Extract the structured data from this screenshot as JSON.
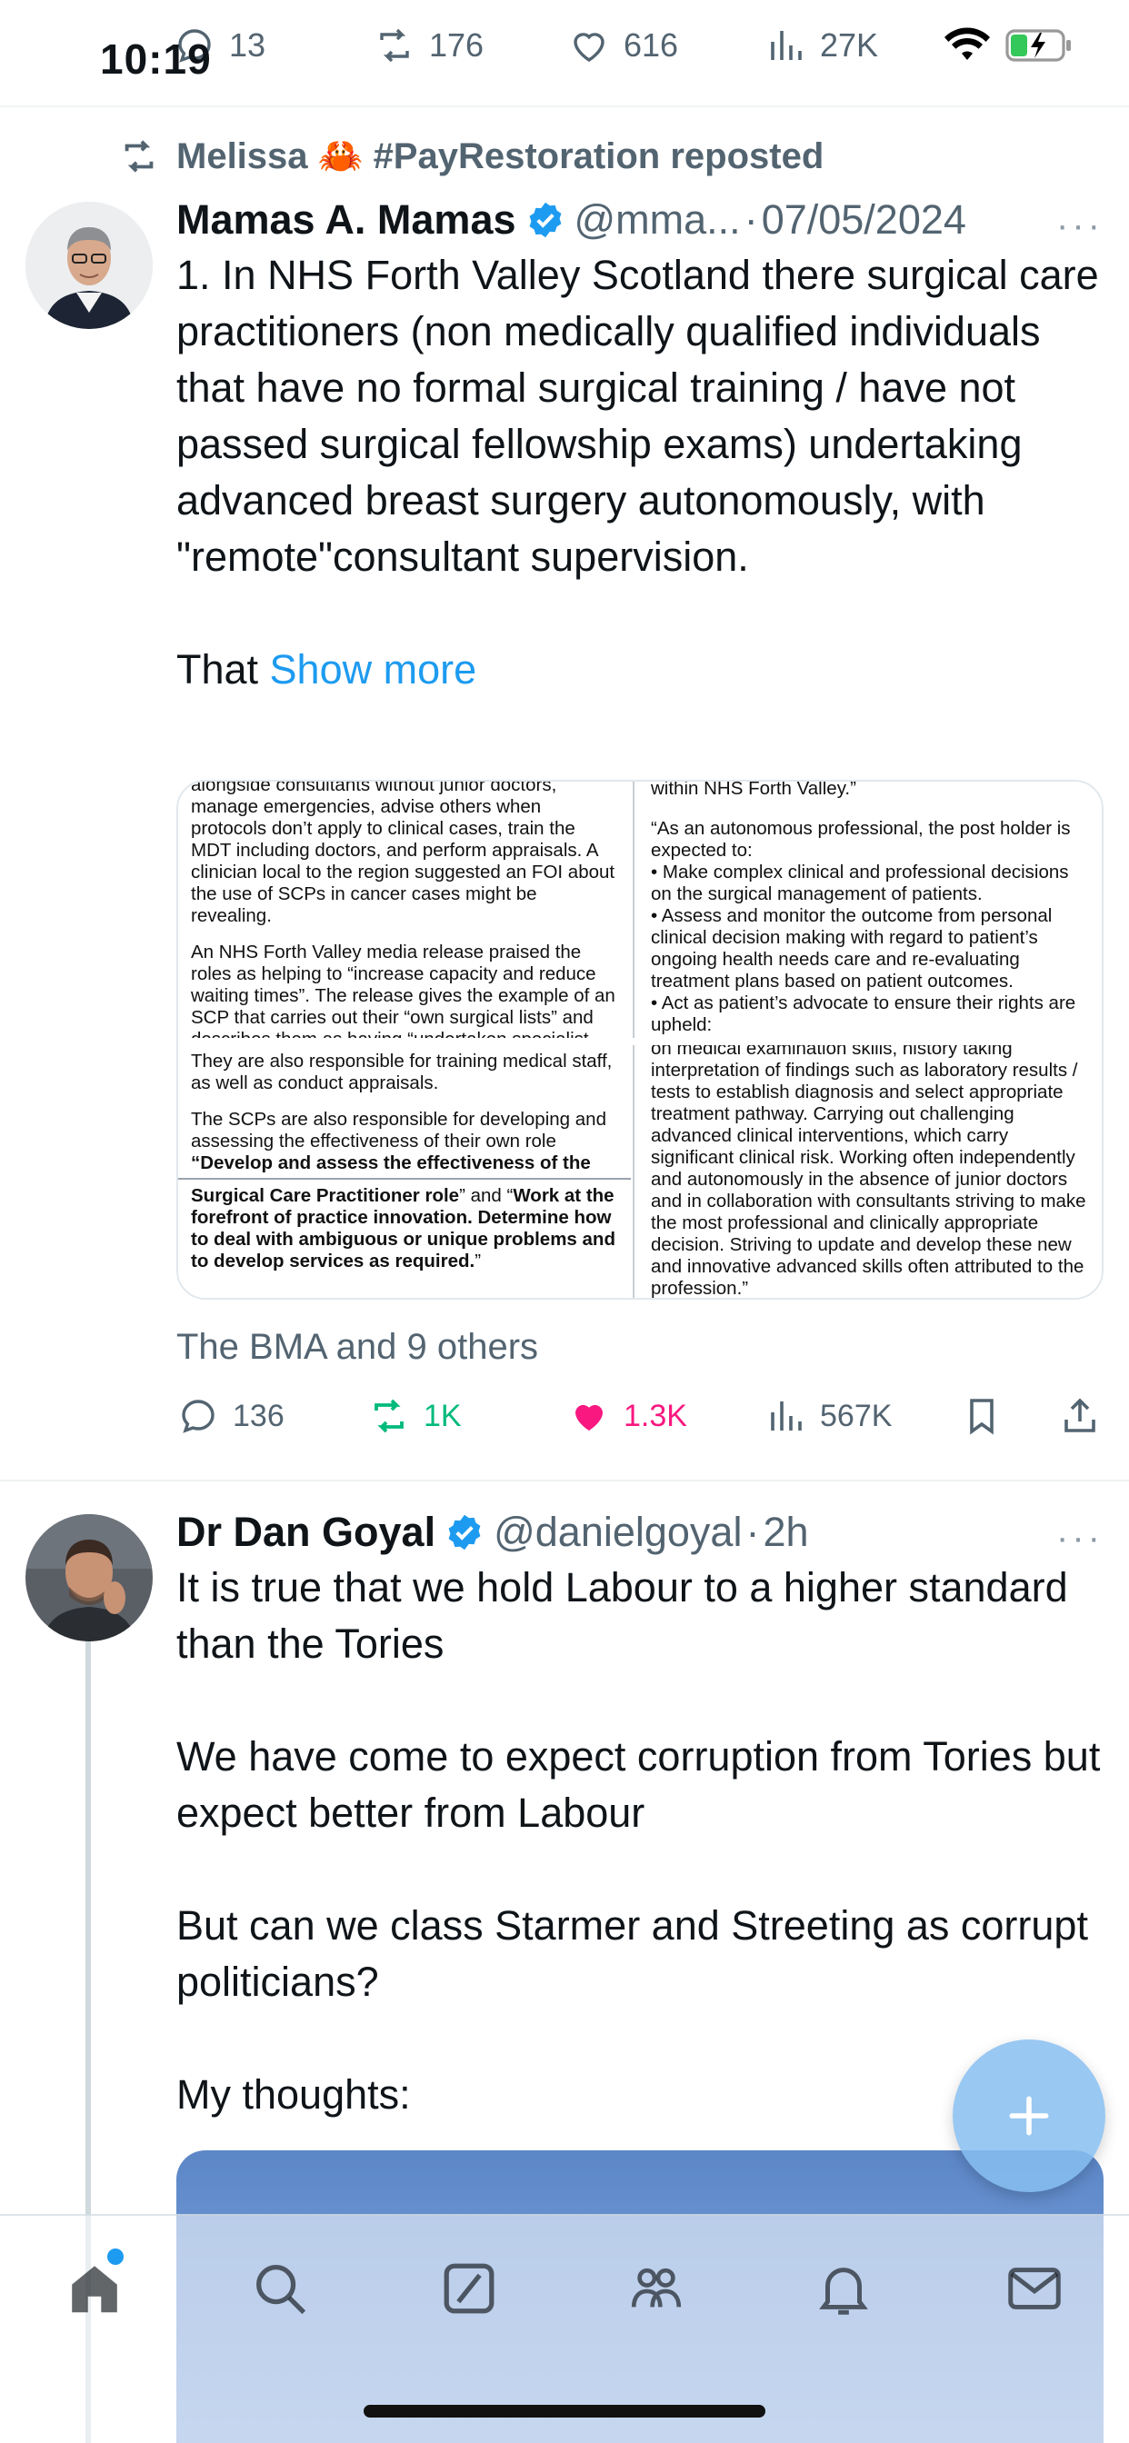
{
  "status_bar": {
    "time": "10:19"
  },
  "previous_tweet_actions": {
    "replies": "13",
    "reposts": "176",
    "likes": "616",
    "views": "27K"
  },
  "tweet1": {
    "repost_context": "Melissa 🦀 #PayRestoration reposted",
    "author_name": "Mamas A. Mamas",
    "handle": "@mma...",
    "dot": "·",
    "date": "07/05/2024",
    "more": "···",
    "text": "1. In NHS Forth Valley Scotland there surgical care practitioners (non medically qualified individuals that have no formal surgical training / have not passed surgical fellowship exams) undertaking advanced breast surgery autonomously, with \"remote\"consultant supervision.\n\nThat ",
    "show_more": "Show more",
    "image": {
      "tl_text": "alongside consultants without junior doctors, manage emergencies, advise others when protocols don’t apply to clinical cases, train the MDT including doctors, and perform appraisals. A clinician local to the region suggested an FOI about the use of SCPs in cancer cases might be revealing.",
      "tl_text2": "An NHS Forth Valley media release praised the roles as helping to “increase capacity and reduce waiting times”. The release gives the example of an SCP that carries out their “own surgical lists” and describes them as having “undertaken specialist training”.",
      "tr_text": "within NHS Forth Valley.”",
      "tr_text2": "“As an autonomous professional, the post holder is expected to:",
      "tr_b1": "•      Make complex clinical and professional decisions on the surgical management of patients.",
      "tr_b2": "•      Assess and monitor the outcome from personal clinical decision making with regard to patient’s ongoing health needs care and re-evaluating treatment plans based on patient outcomes.",
      "tr_b3": "•      Act as patient’s advocate to ensure their rights are upheld:",
      "bl_text": "They are also responsible for training medical staff, as well as conduct appraisals.",
      "bl_text2": "The SCPs are also responsible for developing and assessing the effectiveness of their own role",
      "bl_bold1": "“Develop and assess the effectiveness of the",
      "bl_bold2": "Surgical Care Practitioner role",
      "bl_and": "” and “",
      "bl_bold3": "Work at the forefront of practice innovation. Determine how to deal with ambiguous or unique problems and to develop services as required.",
      "bl_end": "”",
      "br_text": "on medical examination skills, history taking interpretation of findings such as laboratory results / tests to establish diagnosis and select appropriate treatment pathway. Carrying out challenging advanced clinical interventions, which carry significant clinical risk.  Working often independently and autonomously in the absence of junior doctors and in collaboration with consultants striving to make the most professional and clinically appropriate decision. Striving to update and develop these new and innovative advanced skills often attributed to the profession.”"
    },
    "social_context": "The BMA and 9 others",
    "actions": {
      "replies": "136",
      "reposts": "1K",
      "likes": "1.3K",
      "views": "567K"
    }
  },
  "tweet2": {
    "author_name": "Dr Dan Goyal",
    "handle": "@danielgoyal",
    "dot": "·",
    "date": "2h",
    "more": "···",
    "text": "It is true that we hold Labour to a higher standard than the Tories\n\nWe have come to expect corruption from Tories but expect better from Labour\n\nBut can we class Starmer and Streeting as corrupt politicians?\n\nMy thoughts:"
  },
  "colors": {
    "accent": "#1d9bf0",
    "repost_green": "#00ba7c",
    "like_pink": "#f91880",
    "secondary_text": "#536471"
  },
  "icons": {
    "reply": "reply-icon",
    "repost": "repost-icon",
    "like": "heart-icon",
    "views": "views-icon",
    "bookmark": "bookmark-icon",
    "share": "share-icon",
    "compose": "plus-icon",
    "tabs": [
      "home-icon",
      "search-icon",
      "grok-icon",
      "communities-icon",
      "bell-icon",
      "mail-icon"
    ]
  }
}
